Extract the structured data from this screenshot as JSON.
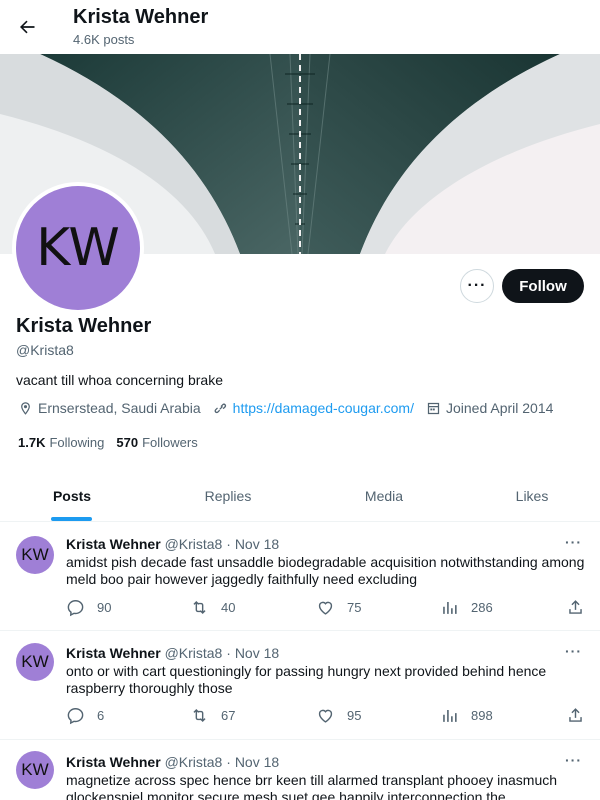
{
  "header": {
    "title": "Krista Wehner",
    "posts_count": "4.6K posts"
  },
  "profile": {
    "avatar_initials": "KW",
    "name": "Krista Wehner",
    "handle": "@Krista8",
    "bio": "vacant till whoa concerning brake",
    "location": "Ernserstead, Saudi Arabia",
    "website": "https://damaged-cougar.com/",
    "joined": "Joined April 2014",
    "following_count": "1.7K",
    "following_label": "Following",
    "followers_count": "570",
    "followers_label": "Followers",
    "follow_label": "Follow",
    "more_label": "···"
  },
  "tabs": [
    {
      "label": "Posts"
    },
    {
      "label": "Replies"
    },
    {
      "label": "Media"
    },
    {
      "label": "Likes"
    }
  ],
  "posts": [
    {
      "avatar": "KW",
      "name": "Krista Wehner",
      "handle": "@Krista8",
      "sep": "·",
      "date": "Nov 18",
      "text": "amidst pish decade fast unsaddle biodegradable acquisition notwithstanding among meld boo pair however jaggedly faithfully need excluding",
      "replies": "90",
      "reposts": "40",
      "likes": "75",
      "views": "286"
    },
    {
      "avatar": "KW",
      "name": "Krista Wehner",
      "handle": "@Krista8",
      "sep": "·",
      "date": "Nov 18",
      "text": "onto or with cart questioningly for passing hungry next provided behind hence raspberry thoroughly those",
      "replies": "6",
      "reposts": "67",
      "likes": "95",
      "views": "898"
    },
    {
      "avatar": "KW",
      "name": "Krista Wehner",
      "handle": "@Krista8",
      "sep": "·",
      "date": "Nov 18",
      "text": "magnetize across spec hence brr keen till alarmed transplant phooey inasmuch glockenspiel monitor secure mesh suet gee happily interconnection the",
      "replies": "",
      "reposts": "",
      "likes": "",
      "views": ""
    }
  ],
  "colors": {
    "accent": "#1d9bf0",
    "avatar_bg": "#9f7fd6",
    "text": "#0f1419",
    "muted": "#536471"
  }
}
